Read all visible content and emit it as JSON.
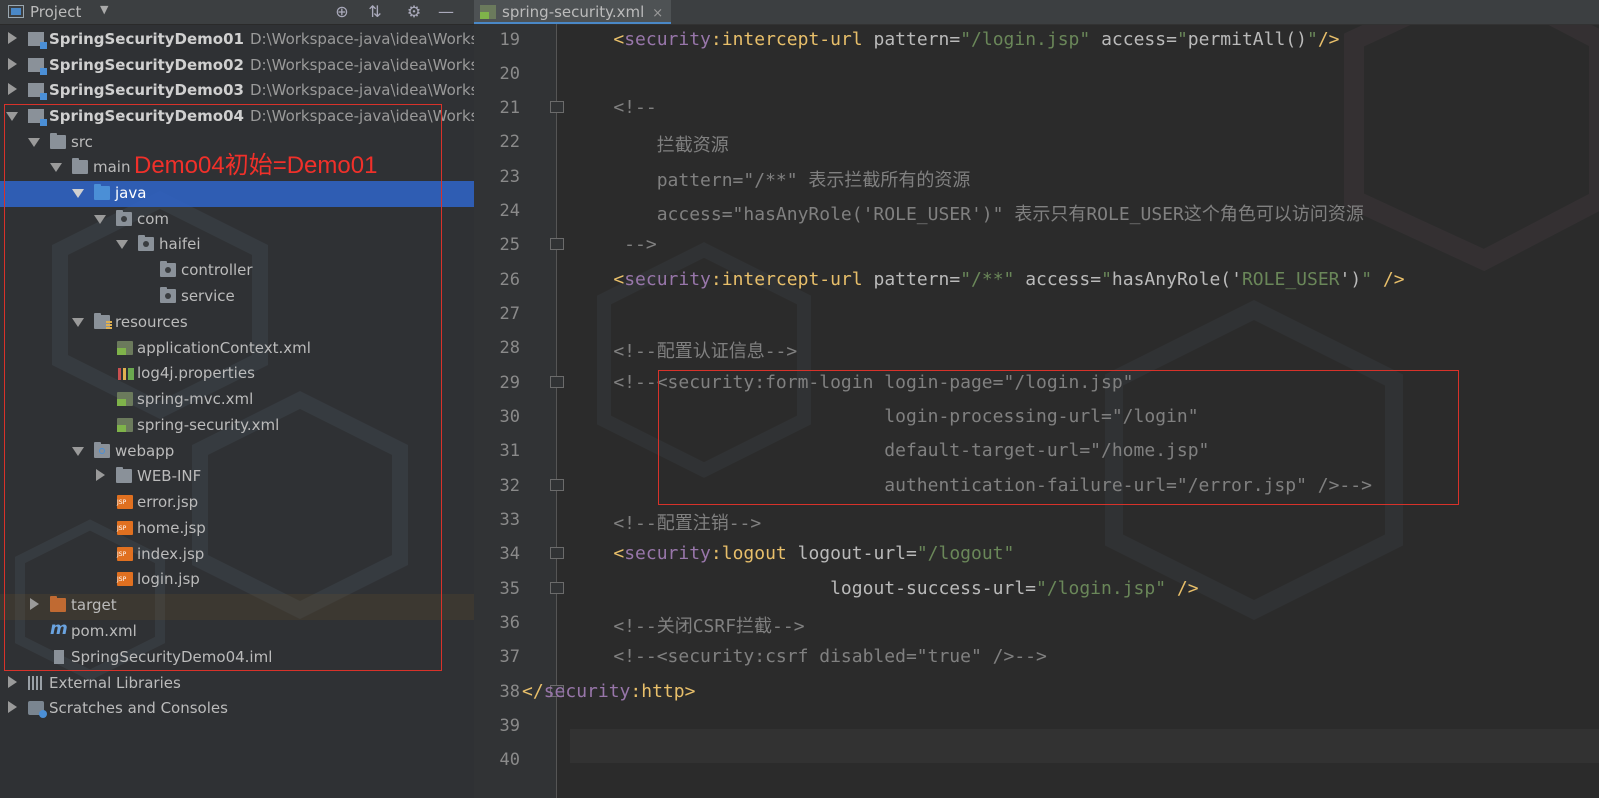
{
  "project_panel": {
    "title": "Project",
    "tree": [
      {
        "label": "SpringSecurityDemo01",
        "path": "D:\\Workspace-java\\idea\\Workspa",
        "bold": true
      },
      {
        "label": "SpringSecurityDemo02",
        "path": "D:\\Workspace-java\\idea\\Workspa",
        "bold": true
      },
      {
        "label": "SpringSecurityDemo03",
        "path": "D:\\Workspace-java\\idea\\Workspa",
        "bold": true
      },
      {
        "label": "SpringSecurityDemo04",
        "path": "D:\\Workspace-java\\idea\\Workspa",
        "bold": true
      },
      {
        "label": "src"
      },
      {
        "label": "main"
      },
      {
        "label": "java"
      },
      {
        "label": "com"
      },
      {
        "label": "haifei"
      },
      {
        "label": "controller"
      },
      {
        "label": "service"
      },
      {
        "label": "resources"
      },
      {
        "label": "applicationContext.xml"
      },
      {
        "label": "log4j.properties"
      },
      {
        "label": "spring-mvc.xml"
      },
      {
        "label": "spring-security.xml"
      },
      {
        "label": "webapp"
      },
      {
        "label": "WEB-INF"
      },
      {
        "label": "error.jsp"
      },
      {
        "label": "home.jsp"
      },
      {
        "label": "index.jsp"
      },
      {
        "label": "login.jsp"
      },
      {
        "label": "target"
      },
      {
        "label": "pom.xml"
      },
      {
        "label": "SpringSecurityDemo04.iml"
      },
      {
        "label": "External Libraries"
      },
      {
        "label": "Scratches and Consoles"
      }
    ],
    "annotation": "Demo04初始=Demo01",
    "icons": {
      "locate": "crosshair-icon",
      "collapse": "collapse-icon",
      "settings": "gear-icon",
      "hide": "minimize-icon"
    }
  },
  "editor": {
    "tab_label": "spring-security.xml",
    "tab_close": "×",
    "line_numbers": [
      "19",
      "20",
      "21",
      "22",
      "23",
      "24",
      "25",
      "26",
      "27",
      "28",
      "29",
      "30",
      "31",
      "32",
      "33",
      "34",
      "35",
      "36",
      "37",
      "38",
      "39",
      "40"
    ],
    "lines": {
      "l19": {
        "indent": "    ",
        "lt": "<",
        "ns": "security",
        "colon": ":",
        "tag": "intercept-url",
        "a1": " pattern=",
        "v1": "\"/login.jsp\"",
        "a2": " access=",
        "v2a": "\"",
        "v2b": "permitAll()",
        "v2c": "\"",
        "end": "/>"
      },
      "l21": "    <!--",
      "l22": "        拦截资源",
      "l23": "        pattern=\"/**\" 表示拦截所有的资源",
      "l24": "        access=\"hasAnyRole('ROLE_USER')\" 表示只有ROLE_USER这个角色可以访问资源",
      "l25": "     -->",
      "l26": {
        "indent": "    ",
        "lt": "<",
        "ns": "security",
        "colon": ":",
        "tag": "intercept-url",
        "a1": " pattern=",
        "v1": "\"/**\"",
        "a2": " access=",
        "v2a": "\"",
        "v2b": "hasAnyRole('",
        "v2c": "ROLE_USER",
        "v2d": "')",
        "v2e": "\"",
        "end": " />"
      },
      "l28": "    <!--配置认证信息-->",
      "l29": "    <!--<security:form-login login-page=\"/login.jsp\"",
      "l30": "                             login-processing-url=\"/login\"",
      "l31": "                             default-target-url=\"/home.jsp\"",
      "l32": "                             authentication-failure-url=\"/error.jsp\" />-->",
      "l33": "    <!--配置注销-->",
      "l34": {
        "indent": "    ",
        "lt": "<",
        "ns": "security",
        "colon": ":",
        "tag": "logout",
        "a1": " logout-url=",
        "v1": "\"/logout\""
      },
      "l35": {
        "indent": "                        ",
        "a1": "logout-success-url=",
        "v1": "\"/login.jsp\"",
        "end": " />"
      },
      "l36": "    <!--关闭CSRF拦截-->",
      "l37": "    <!--<security:csrf disabled=\"true\" />-->",
      "l38": {
        "indent": "",
        "lt": "</",
        "ns": "security",
        "colon": ":",
        "tag": "http",
        "end": ">"
      }
    }
  },
  "colors": {
    "tag": "#e8bf6a",
    "namespace": "#9876aa",
    "attr_value": "#6a8759",
    "comment": "#808080",
    "annotation_red": "#f0302a"
  }
}
